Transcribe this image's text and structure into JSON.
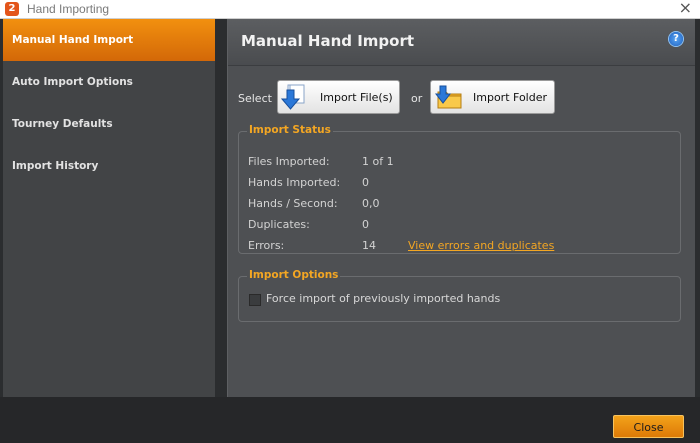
{
  "window": {
    "title": "Hand Importing",
    "app_icon_glyph": "2",
    "close_glyph": "×"
  },
  "sidebar": {
    "items": [
      {
        "label": "Manual Hand Import",
        "active": true
      },
      {
        "label": "Auto Import Options",
        "active": false
      },
      {
        "label": "Tourney Defaults",
        "active": false
      },
      {
        "label": "Import History",
        "active": false
      }
    ]
  },
  "main": {
    "title": "Manual Hand Import",
    "help_glyph": "?",
    "select_label": "Select",
    "or_label": "or",
    "import_files_label": "Import File(s)",
    "import_folder_label": "Import Folder",
    "status": {
      "legend": "Import Status",
      "rows": [
        {
          "label": "Files Imported:",
          "value": "1 of 1"
        },
        {
          "label": "Hands Imported:",
          "value": "0"
        },
        {
          "label": "Hands / Second:",
          "value": "0,0"
        },
        {
          "label": "Duplicates:",
          "value": "0"
        },
        {
          "label": "Errors:",
          "value": "14"
        }
      ],
      "view_errors_link": "View errors and duplicates"
    },
    "options": {
      "legend": "Import Options",
      "force_import_label": "Force import of previously imported hands",
      "force_import_checked": false
    }
  },
  "footer": {
    "close_label": "Close"
  },
  "colors": {
    "accent": "#f3a623",
    "active_nav": "#e8820c",
    "panel": "#4e5053",
    "sidebar": "#424446"
  }
}
